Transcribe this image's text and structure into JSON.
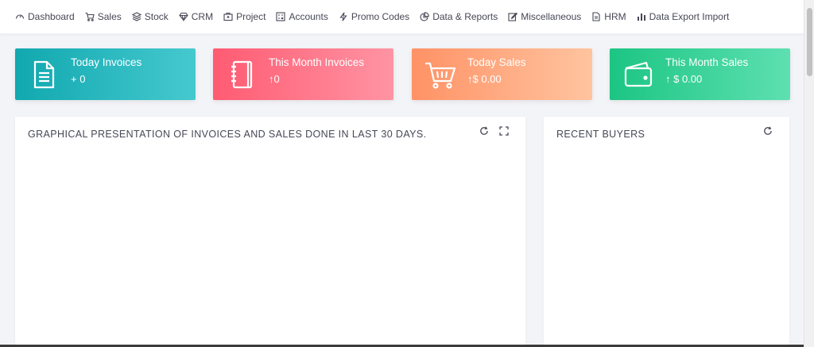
{
  "nav": {
    "items": [
      {
        "label": "Dashboard",
        "icon": "dashboard-gauge-icon"
      },
      {
        "label": "Sales",
        "icon": "shopping-cart-icon"
      },
      {
        "label": "Stock",
        "icon": "layers-icon"
      },
      {
        "label": "CRM",
        "icon": "diamond-icon"
      },
      {
        "label": "Project",
        "icon": "briefcase-icon"
      },
      {
        "label": "Accounts",
        "icon": "calculator-icon"
      },
      {
        "label": "Promo Codes",
        "icon": "lightning-icon"
      },
      {
        "label": "Data & Reports",
        "icon": "pie-icon"
      },
      {
        "label": "Miscellaneous",
        "icon": "edit-icon"
      },
      {
        "label": "HRM",
        "icon": "document-icon"
      },
      {
        "label": "Data Export Import",
        "icon": "bar-chart-icon"
      }
    ]
  },
  "cards": [
    {
      "title": "Today Invoices",
      "value": "+ 0",
      "icon": "invoice-document-icon",
      "color": "#11a8af"
    },
    {
      "title": "This Month Invoices",
      "value": "↑0",
      "icon": "notebook-icon",
      "color": "#ff5b72"
    },
    {
      "title": "Today Sales",
      "value": "↑$ 0.00",
      "icon": "cart-icon",
      "color": "#ff9266"
    },
    {
      "title": "This Month Sales",
      "value": "↑ $ 0.00",
      "icon": "wallet-icon",
      "color": "#1cc583"
    }
  ],
  "panels": {
    "chart": {
      "title": "GRAPHICAL PRESENTATION OF INVOICES AND SALES DONE IN LAST 30 DAYS."
    },
    "buyers": {
      "title": "RECENT BUYERS"
    }
  }
}
